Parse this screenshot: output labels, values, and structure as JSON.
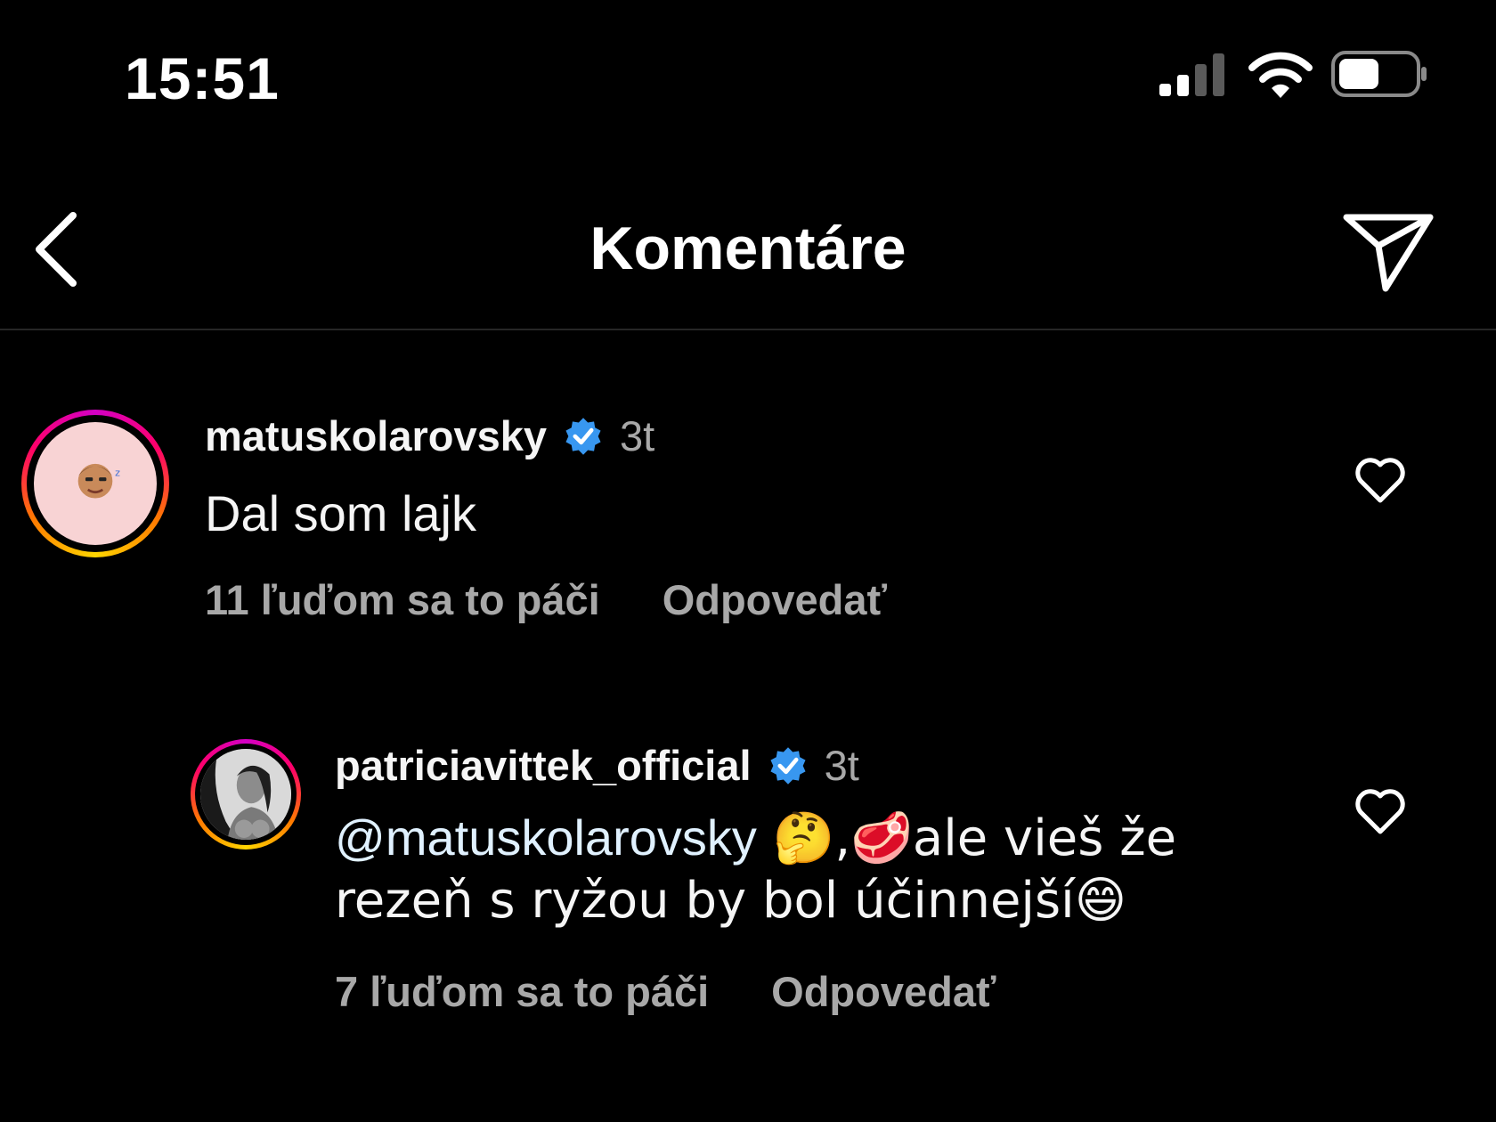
{
  "status_bar": {
    "time": "15:51"
  },
  "header": {
    "title": "Komentáre",
    "back_icon": "chevron-left-icon",
    "share_icon": "paper-plane-icon"
  },
  "colors": {
    "background": "#000000",
    "secondary_text": "#a8a8a8",
    "verified_badge": "#3897f0"
  },
  "comments": [
    {
      "username": "matuskolarovsky",
      "verified": true,
      "time": "3t",
      "text": "Dal som lajk",
      "likes_text": "11 ľuďom sa to páči",
      "reply_label": "Odpovedať"
    },
    {
      "username": "patriciavittek_official",
      "verified": true,
      "time": "3t",
      "mention": "@matuskolarovsky",
      "text_part1": " 🤔,🥩ale vieš že",
      "text_part2": "rezeň s ryžou by bol účinnejší😄",
      "likes_text": "7 ľuďom sa to páči",
      "reply_label": "Odpovedať"
    }
  ]
}
